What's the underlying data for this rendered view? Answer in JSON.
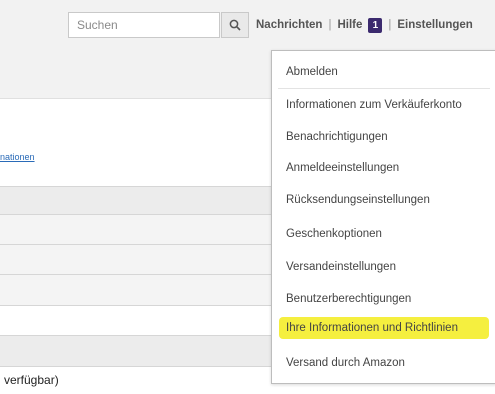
{
  "search": {
    "placeholder": "Suchen"
  },
  "nav": {
    "messages": "Nachrichten",
    "help": "Hilfe",
    "badge": "1",
    "settings": "Einstellungen"
  },
  "left": {
    "link_fragment": "nationen",
    "bottom_text": "verfügbar)"
  },
  "menu": {
    "items": [
      {
        "label": "Abmelden"
      },
      {
        "label": "Informationen zum Verkäuferkonto"
      },
      {
        "label": "Benachrichtigungen"
      },
      {
        "label": "Anmeldeeinstellungen"
      },
      {
        "label": "Rücksendungseinstellungen"
      },
      {
        "label": "Geschenkoptionen"
      },
      {
        "label": "Versandeinstellungen"
      },
      {
        "label": "Benutzerberechtigungen"
      },
      {
        "label": "Ihre Informationen und Richtlinien",
        "highlighted": true
      },
      {
        "label": "Versand durch Amazon"
      }
    ],
    "highlight_color": "#f5ef3f"
  },
  "icons": {
    "search": "search-icon"
  }
}
